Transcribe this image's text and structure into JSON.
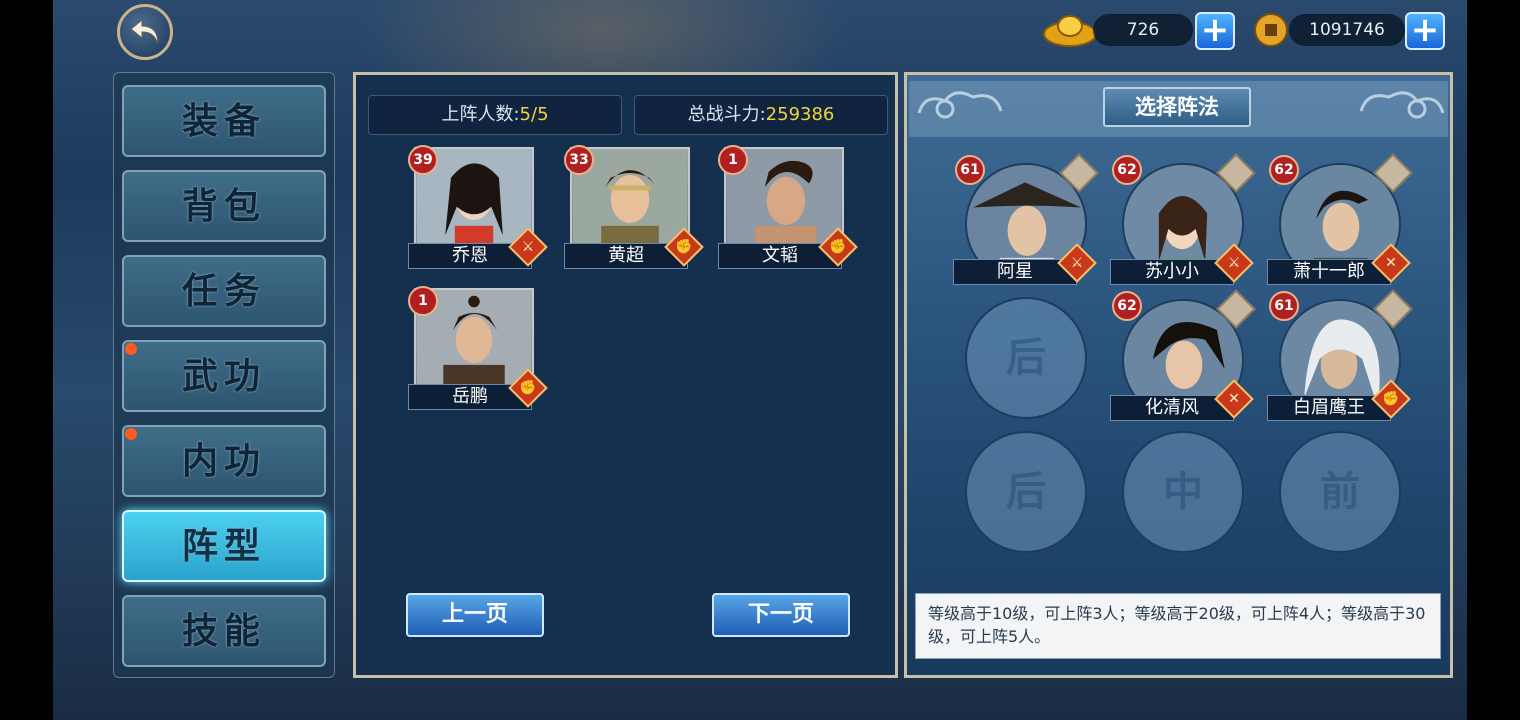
{
  "currency": {
    "gold_ingot": "726",
    "copper_coin": "1091746",
    "add_label": "+"
  },
  "sidebar": {
    "items": [
      {
        "label": "装备",
        "active": false,
        "dot": false
      },
      {
        "label": "背包",
        "active": false,
        "dot": false
      },
      {
        "label": "任务",
        "active": false,
        "dot": false
      },
      {
        "label": "武功",
        "active": false,
        "dot": true
      },
      {
        "label": "内功",
        "active": false,
        "dot": true
      },
      {
        "label": "阵型",
        "active": true,
        "dot": false
      },
      {
        "label": "技能",
        "active": false,
        "dot": false
      }
    ]
  },
  "left_panel": {
    "deploy_label": "上阵人数:",
    "deploy_value": "5/5",
    "power_label": "总战斗力:",
    "power_value": "259386",
    "heroes": [
      {
        "level": "39",
        "name": "乔恩",
        "type_icon": "⚔"
      },
      {
        "level": "33",
        "name": "黄超",
        "type_icon": "✊"
      },
      {
        "level": "1",
        "name": "文韬",
        "type_icon": "✊"
      },
      {
        "level": "1",
        "name": "岳鹏",
        "type_icon": "✊"
      }
    ],
    "prev_page": "上一页",
    "next_page": "下一页"
  },
  "right_panel": {
    "title": "选择阵法",
    "formation": [
      {
        "level": "61",
        "name": "阿星",
        "type_icon": "⚔"
      },
      {
        "level": "62",
        "name": "苏小小",
        "type_icon": "⚔"
      },
      {
        "level": "62",
        "name": "萧十一郎",
        "type_icon": "✕"
      },
      {
        "level": "62",
        "name": "化清风",
        "type_icon": "✕"
      },
      {
        "level": "61",
        "name": "白眉鹰王",
        "type_icon": "✊"
      }
    ],
    "slots": {
      "back_1": "后",
      "back_2": "后",
      "middle": "中",
      "front": "前"
    },
    "info": "等级高于10级，可上阵3人；等级高于20级，可上阵4人；等级高于30级，可上阵5人。"
  },
  "colors": {
    "highlight": "#f2d43a",
    "level_badge": "#b02020",
    "active_tab": "#4cd1f0",
    "plus_button": "#1a66d8"
  }
}
